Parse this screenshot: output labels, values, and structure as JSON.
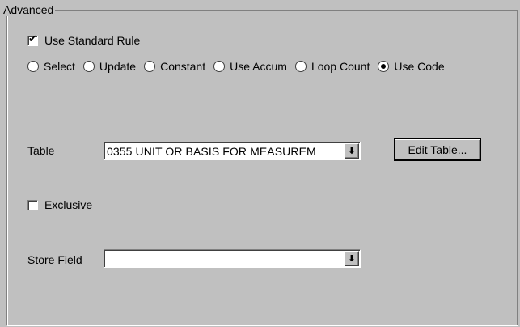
{
  "group": {
    "title": "Advanced"
  },
  "use_standard_rule": {
    "label": "Use Standard Rule",
    "checked": true,
    "mark": "✔"
  },
  "radios": [
    {
      "label": "Select",
      "selected": false
    },
    {
      "label": "Update",
      "selected": false
    },
    {
      "label": "Constant",
      "selected": false
    },
    {
      "label": "Use Accum",
      "selected": false
    },
    {
      "label": "Loop Count",
      "selected": false
    },
    {
      "label": "Use Code",
      "selected": true
    }
  ],
  "table": {
    "label": "Table",
    "value": "0355 UNIT OR BASIS FOR MEASUREM",
    "dropdown_glyph": "⬇"
  },
  "edit_table_button": {
    "label": "Edit Table..."
  },
  "exclusive": {
    "label": "Exclusive",
    "checked": false
  },
  "store_field": {
    "label": "Store Field",
    "value": "",
    "dropdown_glyph": "⬇"
  }
}
